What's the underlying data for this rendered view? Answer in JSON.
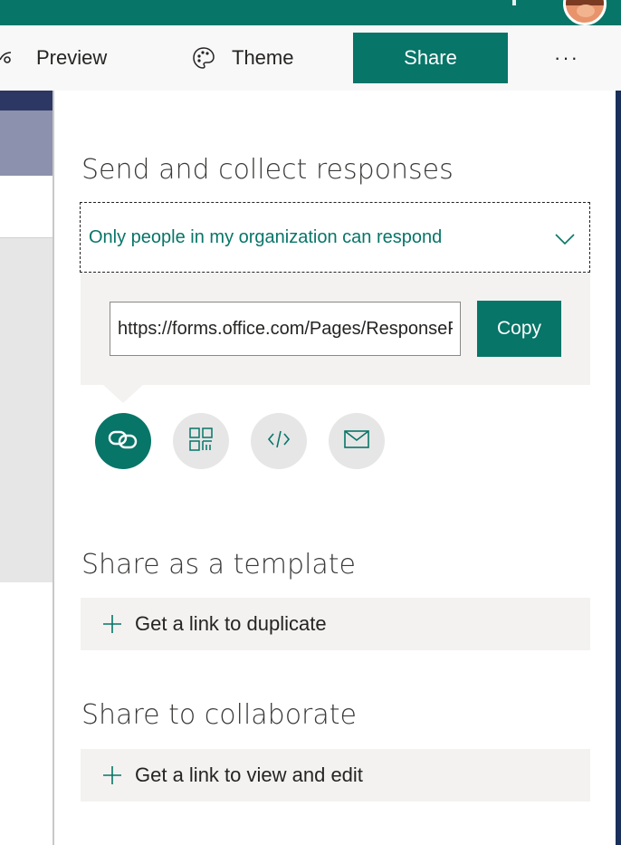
{
  "toolbar": {
    "preview_label": "Preview",
    "theme_label": "Theme",
    "share_label": "Share",
    "more_label": "···"
  },
  "send": {
    "heading": "Send and collect responses",
    "audience_selected": "Only people in my organization can respond",
    "url_value": "https://forms.office.com/Pages/ResponsePage.aspx",
    "copy_label": "Copy",
    "share_methods": [
      "link-icon",
      "qr-code-icon",
      "embed-icon",
      "email-icon"
    ],
    "active_method": "link-icon"
  },
  "template": {
    "heading": "Share as a template",
    "action_label": "Get a link to duplicate"
  },
  "collaborate": {
    "heading": "Share to collaborate",
    "action_label": "Get a link to view and edit"
  },
  "colors": {
    "accent": "#077568",
    "panel_bg": "#f3f2f1",
    "icon_bg": "#e6e6e6"
  }
}
